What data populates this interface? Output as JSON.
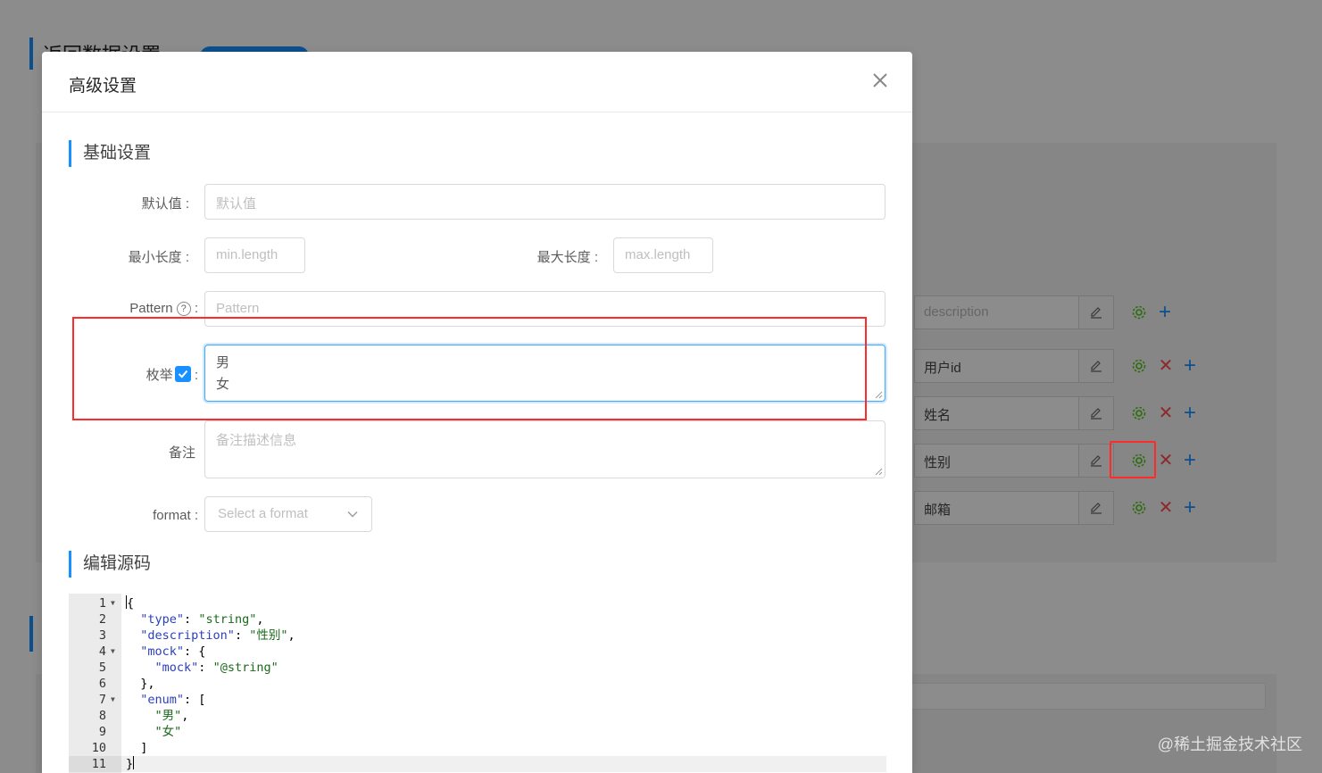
{
  "background": {
    "section_title": "返回数据设置",
    "rows": [
      {
        "value": "description",
        "is_placeholder": true,
        "has_delete": false
      },
      {
        "value": "用户id",
        "is_placeholder": false,
        "has_delete": true
      },
      {
        "value": "姓名",
        "is_placeholder": false,
        "has_delete": true
      },
      {
        "value": "性别",
        "is_placeholder": false,
        "has_delete": true
      },
      {
        "value": "邮箱",
        "is_placeholder": false,
        "has_delete": true
      }
    ],
    "icons": {
      "edit": "edit-icon",
      "settings": "gear-icon",
      "delete": "close-icon",
      "add": "plus-icon"
    },
    "watermark": "@稀土掘金技术社区"
  },
  "modal": {
    "title": "高级设置",
    "close_icon": "close-icon",
    "basic_section_title": "基础设置",
    "default_value": {
      "label": "默认值 :",
      "placeholder": "默认值"
    },
    "min_length": {
      "label": "最小长度 :",
      "placeholder": "min.length"
    },
    "max_length": {
      "label": "最大长度 :",
      "placeholder": "max.length"
    },
    "pattern": {
      "label": "Pattern",
      "help_icon": "question-circle-icon",
      "colon": " :",
      "placeholder": "Pattern"
    },
    "enum": {
      "label": "枚举",
      "checked": true,
      "colon": " :",
      "values": [
        "男",
        "女"
      ]
    },
    "remark": {
      "label": "备注",
      "placeholder": "备注描述信息"
    },
    "format": {
      "label": "format :",
      "placeholder": "Select a format"
    },
    "source_section_title": "编辑源码",
    "code_lines": [
      {
        "n": "1",
        "fold": true,
        "text": "{"
      },
      {
        "n": "2",
        "fold": false,
        "text": "  \"type\": \"string\","
      },
      {
        "n": "3",
        "fold": false,
        "text": "  \"description\": \"性别\","
      },
      {
        "n": "4",
        "fold": true,
        "text": "  \"mock\": {"
      },
      {
        "n": "5",
        "fold": false,
        "text": "    \"mock\": \"@string\""
      },
      {
        "n": "6",
        "fold": false,
        "text": "  },"
      },
      {
        "n": "7",
        "fold": true,
        "text": "  \"enum\": ["
      },
      {
        "n": "8",
        "fold": false,
        "text": "    \"男\","
      },
      {
        "n": "9",
        "fold": false,
        "text": "    \"女\""
      },
      {
        "n": "10",
        "fold": false,
        "text": "  ]"
      },
      {
        "n": "11",
        "fold": false,
        "text": "}"
      }
    ]
  },
  "colors": {
    "accent": "#1890ff",
    "highlight": "#ff2b2b",
    "settings_icon": "#52c41a",
    "delete_icon": "#ff4d4f"
  }
}
